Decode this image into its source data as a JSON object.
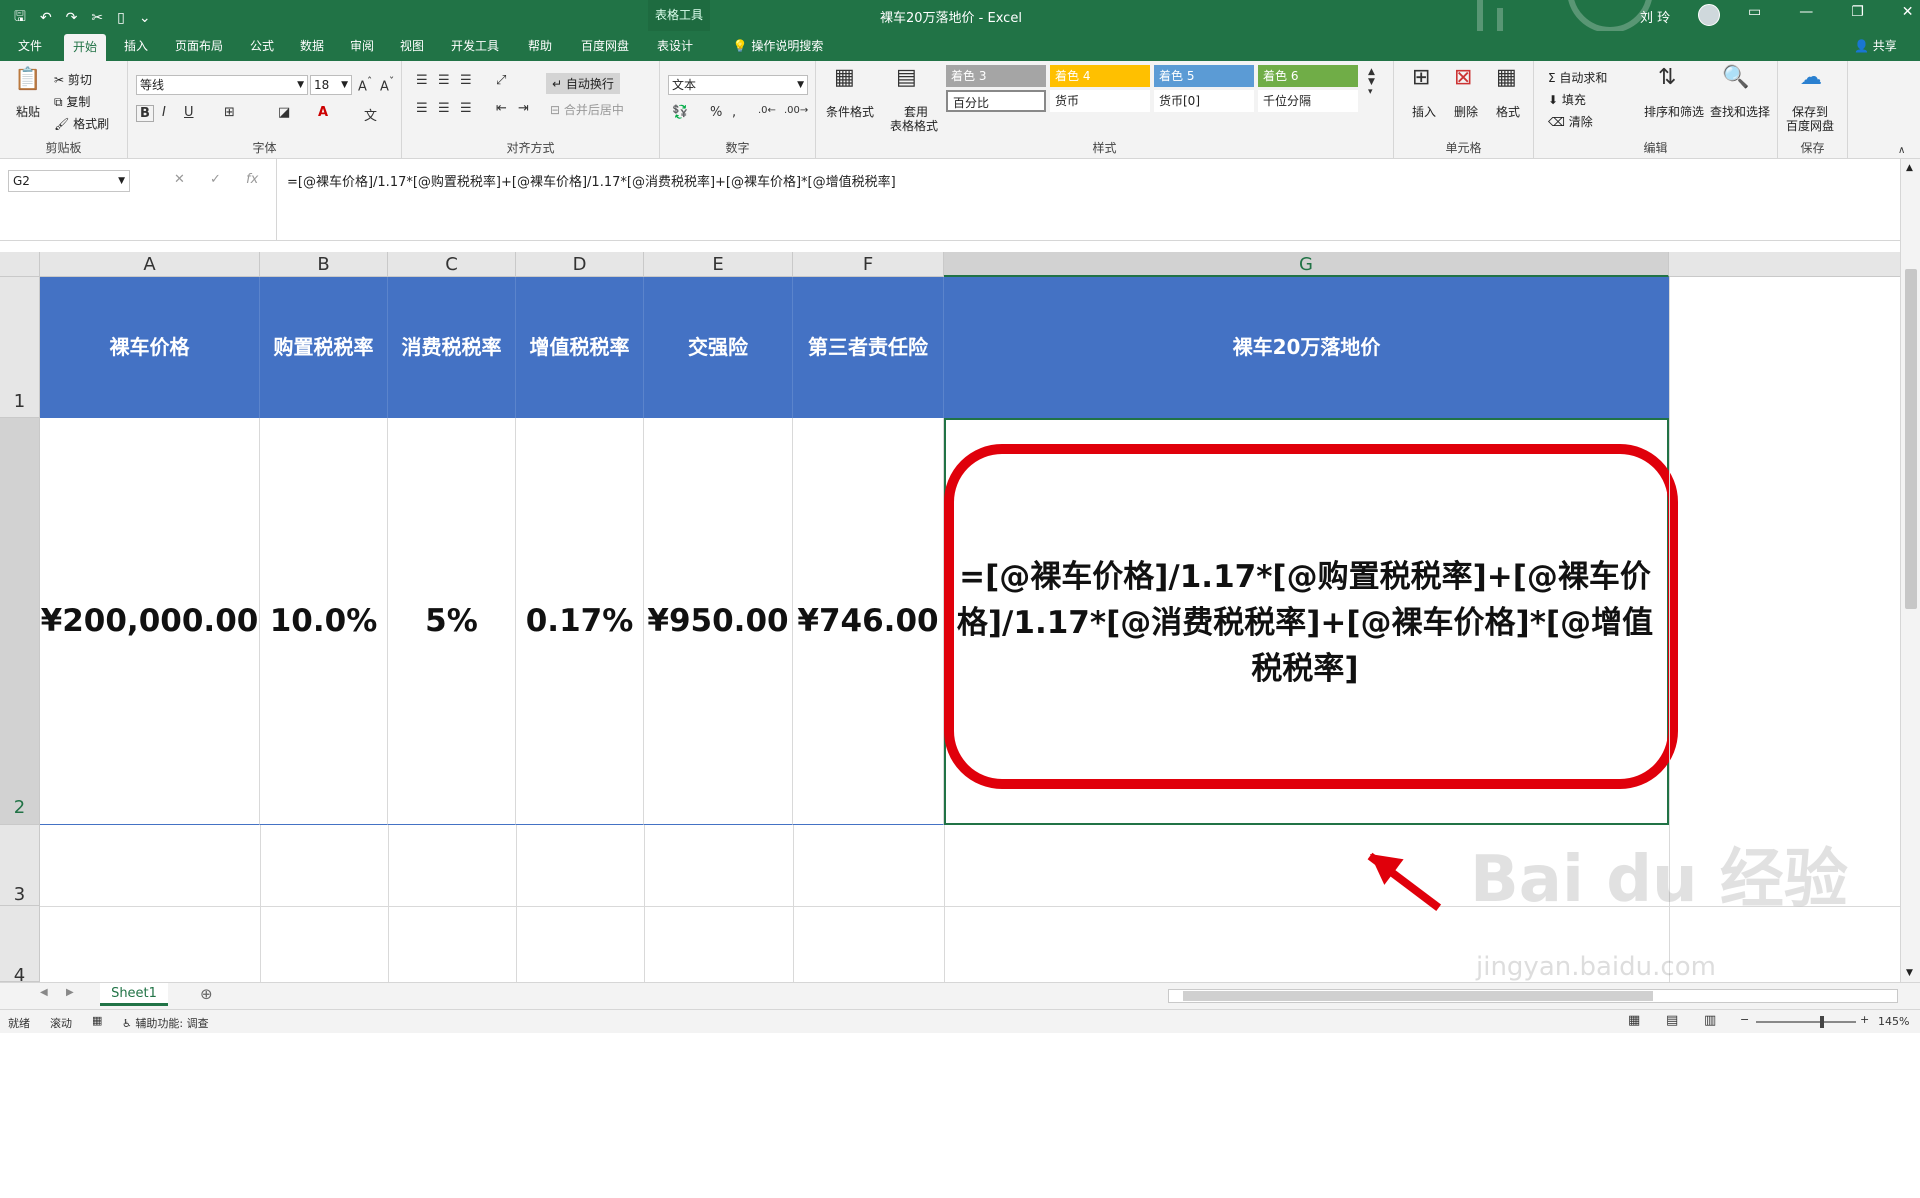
{
  "window": {
    "doc_title": "裸车20万落地价  -  Excel",
    "context_tab_title": "表格工具",
    "user": "刘 玲"
  },
  "tabs": [
    "文件",
    "开始",
    "插入",
    "页面布局",
    "公式",
    "数据",
    "审阅",
    "视图",
    "开发工具",
    "帮助",
    "百度网盘",
    "表设计",
    "操作说明搜索"
  ],
  "share_label": "共享",
  "ribbon": {
    "clipboard": {
      "paste": "粘贴",
      "cut": "剪切",
      "copy": "复制",
      "painter": "格式刷",
      "label": "剪贴板"
    },
    "font": {
      "name": "等线",
      "size": "18",
      "label": "字体"
    },
    "alignment": {
      "wrap": "自动换行",
      "merge": "合并后居中",
      "label": "对齐方式"
    },
    "number": {
      "format": "文本",
      "label": "数字"
    },
    "styles": {
      "conditional": "条件格式",
      "table_format_1": "套用",
      "table_format_2": "表格格式",
      "cells": [
        "着色 3",
        "着色 4",
        "着色 5",
        "着色 6",
        "百分比",
        "货币",
        "货币[0]",
        "千位分隔"
      ],
      "label": "样式"
    },
    "cells": {
      "insert": "插入",
      "delete": "删除",
      "format": "格式",
      "label": "单元格"
    },
    "editing": {
      "autosum": "自动求和",
      "fill": "填充",
      "clear": "清除",
      "sort": "排序和筛选",
      "find": "查找和选择",
      "label": "编辑"
    },
    "save": {
      "line1": "保存到",
      "line2": "百度网盘",
      "label": "保存"
    }
  },
  "colors": {
    "excel_green": "#217346",
    "header_blue": "#4472c4",
    "highlight_red": "#e0000b"
  },
  "formula_bar": {
    "name_box": "G2",
    "formula": "=[@裸车价格]/1.17*[@购置税税率]+[@裸车价格]/1.17*[@消费税税率]+[@裸车价格]*[@增值税税率]"
  },
  "columns": [
    "A",
    "B",
    "C",
    "D",
    "E",
    "F",
    "G"
  ],
  "rows": [
    "1",
    "2",
    "3",
    "4"
  ],
  "table": {
    "headers": [
      "裸车价格",
      "购置税税率",
      "消费税税率",
      "增值税税率",
      "交强险",
      "第三者责任险",
      "裸车20万落地价"
    ],
    "row": [
      "¥200,000.00",
      "10.0%",
      "5%",
      "0.17%",
      "¥950.00",
      "¥746.00"
    ],
    "g2_formula": "=[@裸车价格]/1.17*[@购置税税率]+[@裸车价格]/1.17*[@消费税税率]+[@裸车价格]*[@增值税税率]"
  },
  "sheet_tab": "Sheet1",
  "status": {
    "ready": "就绪",
    "scroll": "滚动",
    "accessibility": "辅助功能: 调查",
    "zoom": "145%"
  },
  "watermark": {
    "line1": "Bai du 经验",
    "line2": "jingyan.baidu.com"
  }
}
